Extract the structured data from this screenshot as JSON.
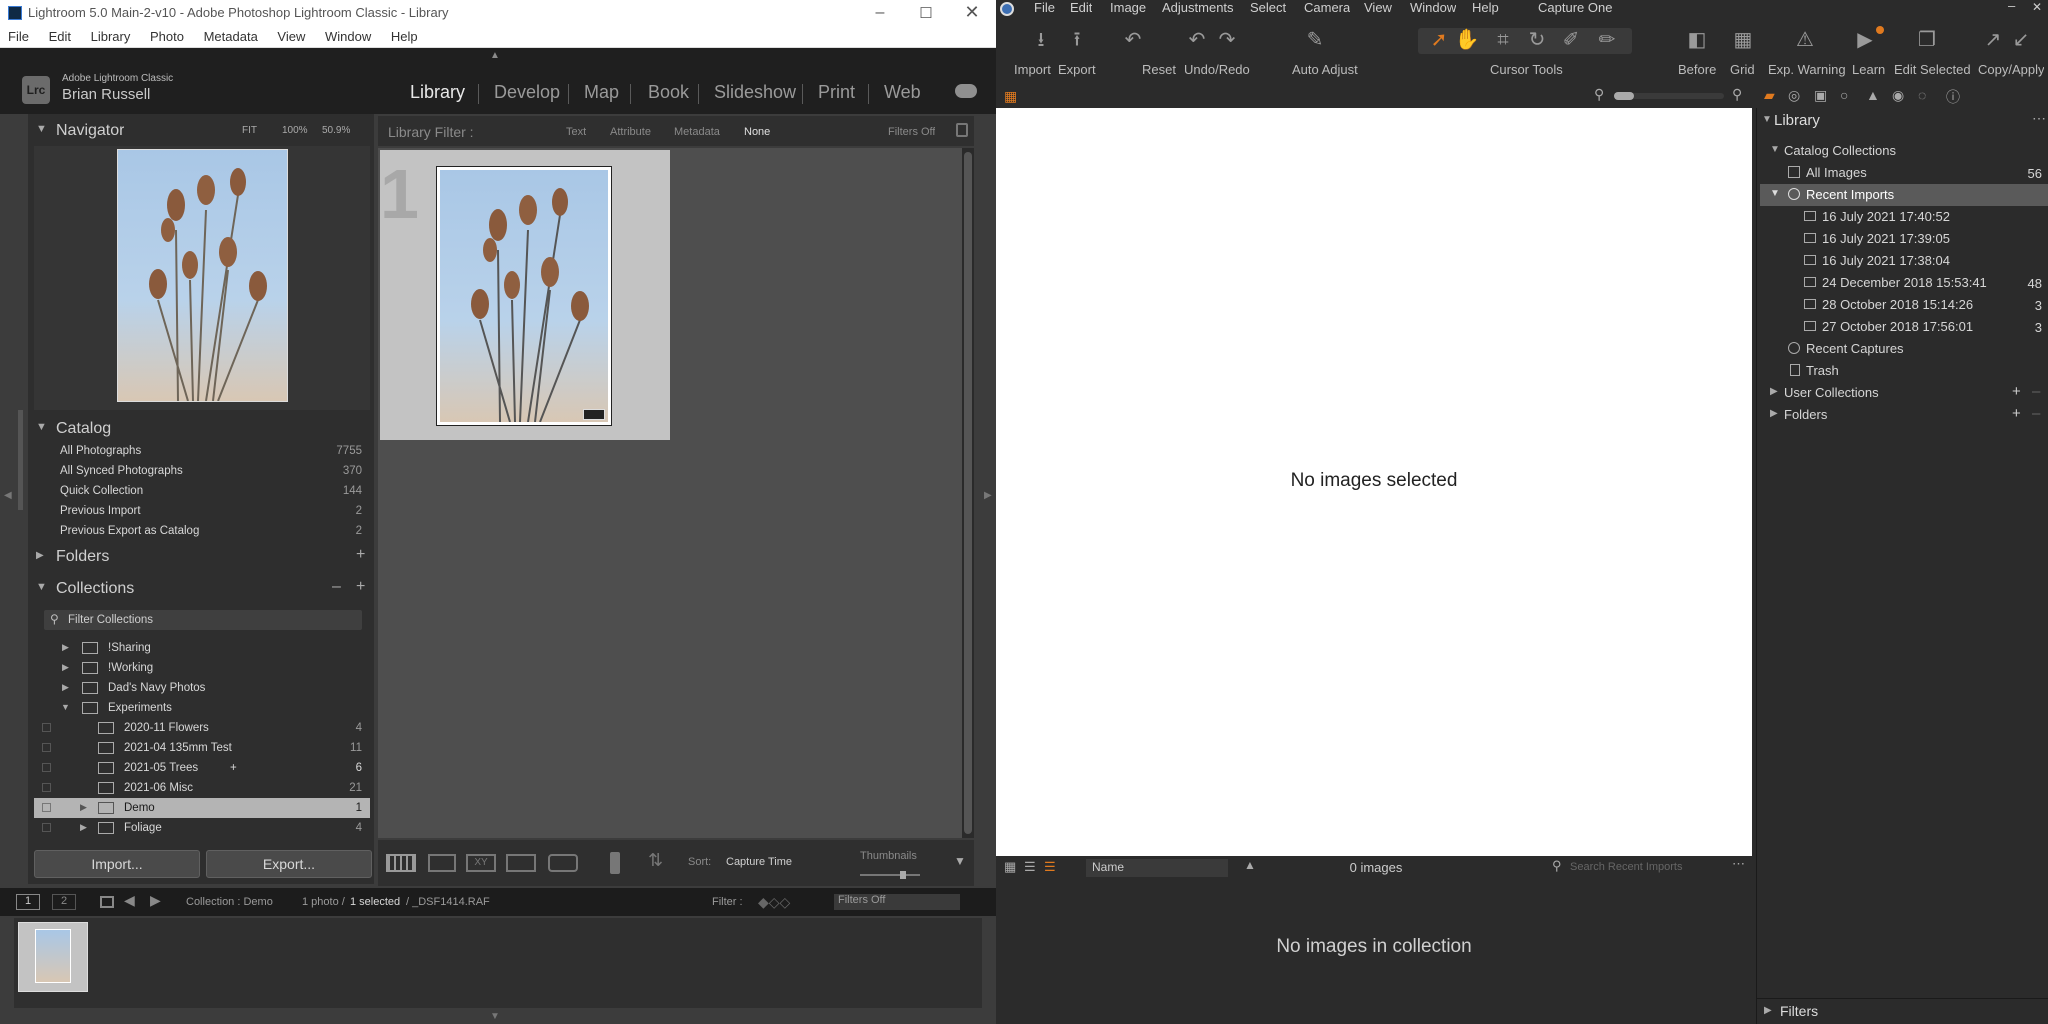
{
  "lightroom": {
    "window_title": "Lightroom 5.0 Main-2-v10 - Adobe Photoshop Lightroom Classic - Library",
    "menu": [
      "File",
      "Edit",
      "Library",
      "Photo",
      "Metadata",
      "View",
      "Window",
      "Help"
    ],
    "brand": "Adobe Lightroom Classic",
    "user": "Brian Russell",
    "logo": "Lrc",
    "modules": [
      "Library",
      "Develop",
      "Map",
      "Book",
      "Slideshow",
      "Print",
      "Web"
    ],
    "navigator": {
      "title": "Navigator",
      "zoom": [
        "FIT",
        "100%",
        "50.9%"
      ]
    },
    "filter_bar": {
      "label": "Library Filter :",
      "tabs": [
        "Text",
        "Attribute",
        "Metadata",
        "None"
      ],
      "filters_off": "Filters Off"
    },
    "grid_cell_index": "1",
    "catalog": {
      "title": "Catalog",
      "items": [
        {
          "label": "All Photographs",
          "count": "7755"
        },
        {
          "label": "All Synced Photographs",
          "count": "370"
        },
        {
          "label": "Quick Collection",
          "count": "144"
        },
        {
          "label": "Previous Import",
          "count": "2"
        },
        {
          "label": "Previous Export as Catalog",
          "count": "2"
        }
      ]
    },
    "folders": {
      "title": "Folders"
    },
    "collections": {
      "title": "Collections",
      "filter_placeholder": "Filter Collections",
      "items": [
        {
          "label": "!Sharing",
          "count": ""
        },
        {
          "label": "!Working",
          "count": ""
        },
        {
          "label": "Dad's Navy Photos",
          "count": ""
        },
        {
          "label": "Experiments",
          "count": ""
        },
        {
          "label": "2020-11 Flowers",
          "count": "4"
        },
        {
          "label": "2021-04 135mm Test",
          "count": "11"
        },
        {
          "label": "2021-05 Trees",
          "count": "6"
        },
        {
          "label": "2021-06 Misc",
          "count": "21"
        },
        {
          "label": "Demo",
          "count": "1"
        },
        {
          "label": "Foliage",
          "count": "4"
        }
      ],
      "trees_plus": "+"
    },
    "import_button": "Import...",
    "export_button": "Export...",
    "toolbar": {
      "sort_label": "Sort:",
      "sort_value": "Capture Time",
      "thumbnails_label": "Thumbnails"
    },
    "filmstrip": {
      "pages": [
        "1",
        "2"
      ],
      "collection": "Collection : Demo",
      "photo_count": "1 photo /",
      "selected": "1 selected",
      "file": "/ _DSF1414.RAF",
      "filter_label": "Filter :",
      "filters_off": "Filters Off"
    }
  },
  "capture_one": {
    "app_title": "Capture One",
    "menu": [
      "File",
      "Edit",
      "Image",
      "Adjustments",
      "Select",
      "Camera",
      "View",
      "Window",
      "Help"
    ],
    "toolbar": [
      "Import",
      "Export",
      "Reset",
      "Undo/Redo",
      "Auto Adjust",
      "Cursor Tools",
      "Before",
      "Grid",
      "Exp. Warning",
      "Learn",
      "Edit Selected",
      "Copy/Apply"
    ],
    "viewer_message": "No images selected",
    "browser": {
      "sort_value": "Name",
      "count": "0 images",
      "search_placeholder": "Search Recent Imports",
      "empty_message": "No images in collection"
    },
    "library": {
      "title": "Library",
      "catalog_collections": "Catalog Collections",
      "all_images": {
        "label": "All Images",
        "count": "56"
      },
      "recent_imports": "Recent Imports",
      "imports": [
        {
          "label": "16 July 2021 17:40:52",
          "count": ""
        },
        {
          "label": "16 July 2021 17:39:05",
          "count": ""
        },
        {
          "label": "16 July 2021 17:38:04",
          "count": ""
        },
        {
          "label": "24 December 2018 15:53:41",
          "count": "48"
        },
        {
          "label": "28 October 2018 15:14:26",
          "count": "3"
        },
        {
          "label": "27 October 2018 17:56:01",
          "count": "3"
        }
      ],
      "recent_captures": "Recent Captures",
      "trash": "Trash",
      "user_collections": "User Collections",
      "folders": "Folders"
    },
    "filters": "Filters"
  }
}
